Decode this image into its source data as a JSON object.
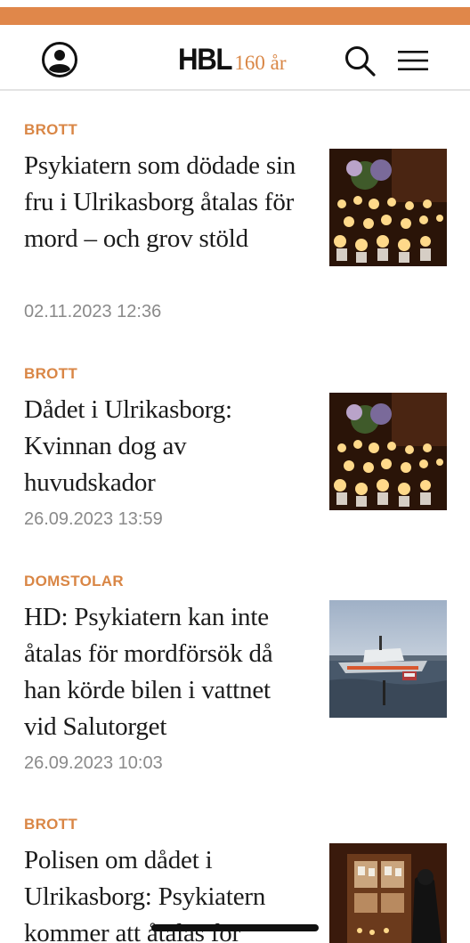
{
  "header": {
    "logo_text": "HBL",
    "logo_sub": "160 år",
    "accent_color": "#e0874a",
    "icons": [
      "user-icon",
      "search-icon",
      "hamburger-menu-icon"
    ]
  },
  "articles": [
    {
      "category": "BROTT",
      "title": "Psykiatern som dödade sin fru i Ulrikasborg åtalas för mord – och grov stöld",
      "date": "02.11.2023 12:36",
      "thumbnail": "candles"
    },
    {
      "category": "BROTT",
      "title": "Dådet i Ulrikasborg: Kvinnan dog av huvudskador",
      "date": "26.09.2023 13:59",
      "thumbnail": "candles"
    },
    {
      "category": "DOMSTOLAR",
      "title": "HD: Psykiatern kan inte åtalas för mordförsök då han körde bilen i vattnet vid Salutorget",
      "date": "26.09.2023 10:03",
      "thumbnail": "rescue boat"
    },
    {
      "category": "BROTT",
      "title": "Polisen om dådet i Ulrikasborg: Psykiatern kommer att åtalas för",
      "date": "",
      "thumbnail": "doorway with candles"
    }
  ]
}
